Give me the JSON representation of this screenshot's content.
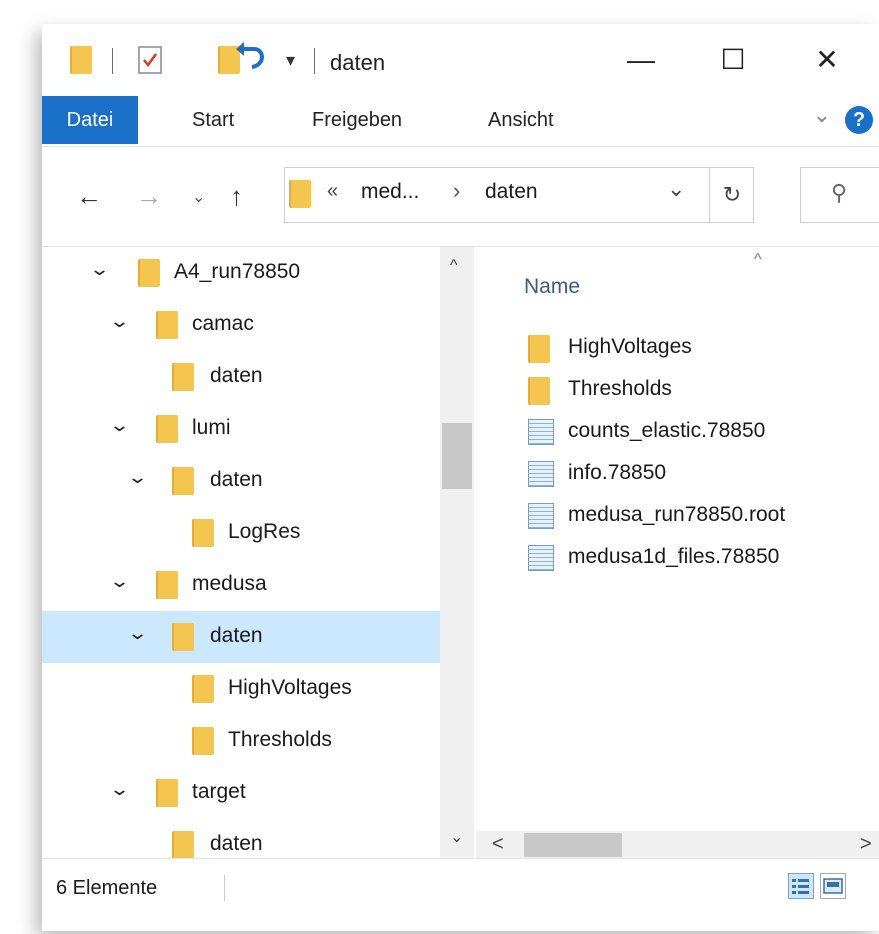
{
  "window": {
    "title": "daten",
    "controls": {
      "minimize": "—",
      "maximize": "☐",
      "close": "✕"
    }
  },
  "quick_access": {
    "customize": "▾"
  },
  "ribbon": {
    "tabs": [
      {
        "label": "Datei",
        "active": true
      },
      {
        "label": "Start"
      },
      {
        "label": "Freigeben"
      },
      {
        "label": "Ansicht"
      }
    ],
    "expand": "⌄",
    "help": "?"
  },
  "address": {
    "back": "←",
    "forward": "→",
    "recent": "⌄",
    "up": "↑",
    "overflow": "«",
    "crumbs": [
      "med...",
      "daten"
    ],
    "separator": "›",
    "dropdown": "⌄",
    "refresh": "↻",
    "search_icon": "⚲"
  },
  "tree": {
    "items": [
      {
        "label": "A4_run78850",
        "expanded": true
      },
      {
        "label": "camac",
        "expanded": true
      },
      {
        "label": "daten",
        "expanded": false
      },
      {
        "label": "lumi",
        "expanded": true
      },
      {
        "label": "daten",
        "expanded": true
      },
      {
        "label": "LogRes",
        "expanded": false
      },
      {
        "label": "medusa",
        "expanded": true
      },
      {
        "label": "daten",
        "expanded": true,
        "selected": true
      },
      {
        "label": "HighVoltages",
        "expanded": false
      },
      {
        "label": "Thresholds",
        "expanded": false
      },
      {
        "label": "target",
        "expanded": true
      },
      {
        "label": "daten",
        "expanded": false
      }
    ],
    "chevron": "⌄",
    "scroll_up": "^",
    "scroll_down": "⌄"
  },
  "files": {
    "column_header": "Name",
    "sort_indicator": "^",
    "items": [
      {
        "name": "HighVoltages",
        "type": "folder"
      },
      {
        "name": "Thresholds",
        "type": "folder"
      },
      {
        "name": "counts_elastic.78850",
        "type": "file"
      },
      {
        "name": "info.78850",
        "type": "file"
      },
      {
        "name": "medusa_run78850.root",
        "type": "file"
      },
      {
        "name": "medusa1d_files.78850",
        "type": "file"
      }
    ],
    "scroll_left": "<",
    "scroll_right": ">"
  },
  "status": {
    "item_count": "6 Elemente"
  }
}
